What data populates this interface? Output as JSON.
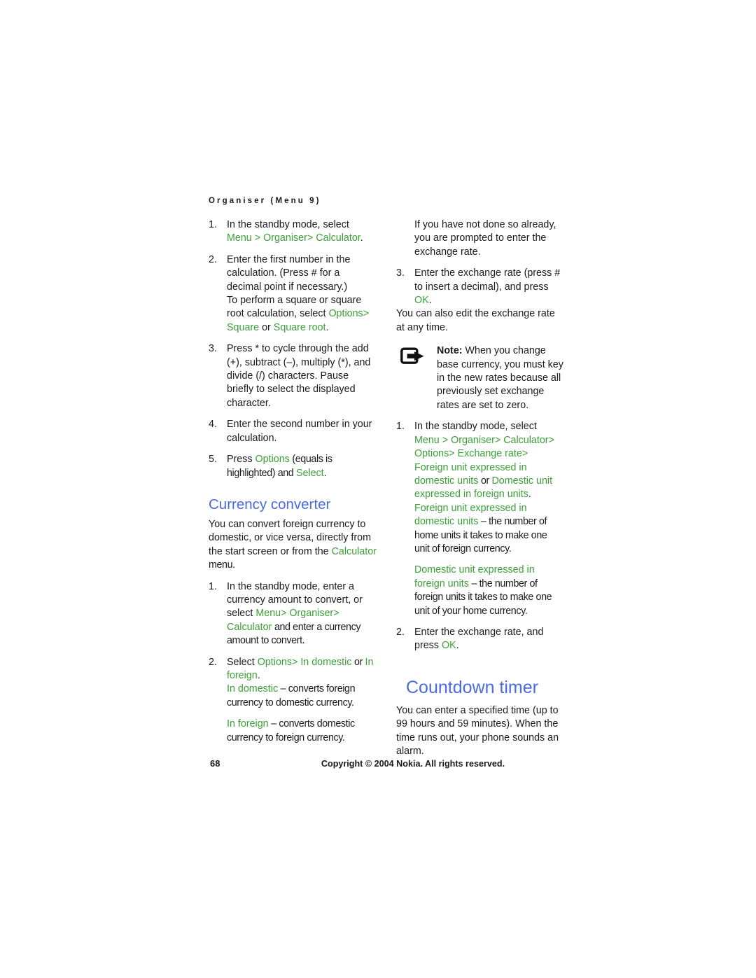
{
  "page": {
    "running_header": "Organiser (Menu 9)",
    "page_number": "68",
    "copyright": "Copyright © 2004 Nokia. All rights reserved.",
    "accent_green": "#3ba035",
    "accent_blue": "#4a6ade",
    "text_color": "#1a1a1a"
  },
  "left_column": {
    "calculator_steps": {
      "n1": "1.",
      "s1_a": "In the standby mode, select ",
      "s1_menu": "Menu",
      "s1_sep1": "> ",
      "s1_organiser": "Organiser",
      "s1_sep2": ">",
      "s1_calculator": "Calculator",
      "s1_period": ".",
      "n2": "2.",
      "s2": "Enter the first number in the calculation. (Press # for a decimal point if necessary.)",
      "s2_cont_a": "To perform a square or square root calculation, select ",
      "s2_cont_options": "Options",
      "s2_cont_sep": ">",
      "s2_cont_square": "Square",
      "s2_cont_or": " or ",
      "s2_cont_squareroot": "Square root",
      "s2_cont_period": ".",
      "n3": "3.",
      "s3": "Press * to cycle through the add (+), subtract (–), multiply (*), and divide (/) characters. Pause briefly to select the displayed character.",
      "n4": "4.",
      "s4": "Enter the second number in your calculation.",
      "n5": "5.",
      "s5_a": "Press ",
      "s5_options": "Options",
      "s5_b": " (equals is highlighted) and ",
      "s5_select": "Select",
      "s5_period": "."
    },
    "currency_converter": {
      "heading": "Currency converter",
      "intro_a": "You can convert foreign currency to domestic, or vice versa, directly from the start screen or from the ",
      "intro_calculator": "Calculator",
      "intro_b": " menu.",
      "n1": "1.",
      "s1_a": "In the standby mode, enter a currency amount to convert, or select ",
      "s1_menu": "Menu",
      "s1_sep1": "> ",
      "s1_organiser": "Organiser",
      "s1_sep2": ">",
      "s1_calculator": "Calculator",
      "s1_b": " and enter a currency amount to convert.",
      "n2": "2.",
      "s2_a": "Select ",
      "s2_options": "Options",
      "s2_sep": "> ",
      "s2_indomestic": "In domestic",
      "s2_or": " or ",
      "s2_inforeign": "In foreign",
      "s2_period": ".",
      "d1_term": "In domestic",
      "d1_text": " – converts foreign currency to domestic currency.",
      "d2_term": "In foreign",
      "d2_text": " – converts domestic currency to foreign currency."
    }
  },
  "right_column": {
    "exchange_rate_prompt": "If you have not done so already, you are prompted to enter the exchange rate.",
    "step3_num": "3.",
    "step3_a": "Enter the exchange rate (press # to insert a decimal), and press ",
    "step3_ok": "OK",
    "step3_period": ".",
    "edit_anytime": "You can also edit the exchange rate at any time.",
    "note": {
      "icon": "note-arrow-icon",
      "label": "Note:",
      "text": " When you change base currency, you must key in the new rates because all previously set exchange rates are set to zero."
    },
    "base_currency_steps": {
      "n1": "1.",
      "s1_a": "In the standby mode, select ",
      "s1_menu": "Menu",
      "s1_sep1": "> ",
      "s1_organiser": "Organiser",
      "s1_sep2": ">",
      "s1_calculator": "Calculator",
      "s1_sep3": ">",
      "s1_options": "Options",
      "s1_sep4": "> ",
      "s1_exchangerate": "Exchange rate",
      "s1_sep5": ">",
      "s1_foreign_unit": "Foreign unit expressed in domestic units",
      "s1_or": " or ",
      "s1_domestic_unit": "Domestic unit expressed in foreign units",
      "s1_period": ".",
      "d1_term": "Foreign unit expressed in domestic units",
      "d1_text": " – the number of home units it takes to make one unit of foreign currency.",
      "d2_term": "Domestic unit expressed in foreign units",
      "d2_text": " – the number of foreign units it takes to make one unit of your home currency.",
      "n2": "2.",
      "s2_a": "Enter the exchange rate, and press ",
      "s2_ok": "OK",
      "s2_period": "."
    },
    "countdown_timer": {
      "heading": "Countdown timer",
      "intro": "You can enter a specified time (up to 99 hours and 59 minutes). When the time runs out, your phone sounds an alarm."
    }
  }
}
